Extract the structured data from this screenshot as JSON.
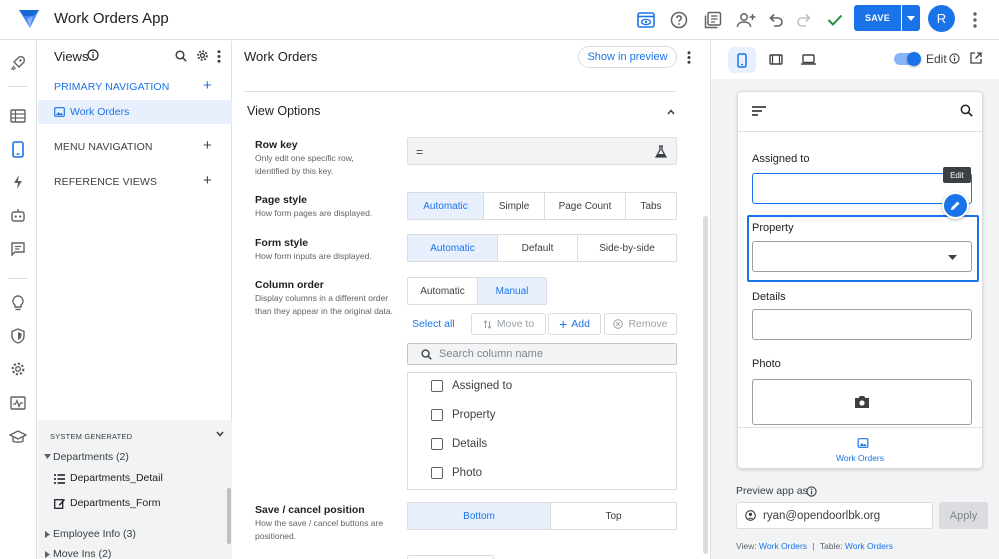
{
  "app": {
    "title": "Work Orders App",
    "save_label": "SAVE",
    "avatar_letter": "R",
    "brand_color": "#1a73e8"
  },
  "views_panel": {
    "title": "Views",
    "sections": [
      {
        "label": "PRIMARY NAVIGATION",
        "items": [
          "Work Orders"
        ]
      },
      {
        "label": "MENU NAVIGATION"
      },
      {
        "label": "REFERENCE VIEWS"
      }
    ],
    "system_generated": {
      "label": "SYSTEM GENERATED",
      "groups": [
        {
          "label": "Departments (2)",
          "children": [
            "Departments_Detail",
            "Departments_Form"
          ]
        },
        {
          "label": "Employee Info (3)"
        },
        {
          "label": "Move Ins (2)"
        }
      ]
    }
  },
  "center": {
    "title": "Work Orders",
    "show_preview": "Show in preview",
    "view_options": "View Options",
    "row_key": {
      "title": "Row key",
      "desc": "Only edit one specific row, identified by this key.",
      "value": "="
    },
    "page_style": {
      "title": "Page style",
      "desc": "How form pages are displayed.",
      "options": [
        "Automatic",
        "Simple",
        "Page Count",
        "Tabs"
      ],
      "selected": "Automatic"
    },
    "form_style": {
      "title": "Form style",
      "desc": "How form inputs are displayed.",
      "options": [
        "Automatic",
        "Default",
        "Side-by-side"
      ],
      "selected": "Automatic"
    },
    "column_order": {
      "title": "Column order",
      "desc": "Display columns in a different order than they appear in the original data.",
      "options": [
        "Automatic",
        "Manual"
      ],
      "selected": "Manual",
      "select_all": "Select all",
      "move_to": "Move to",
      "add": "Add",
      "remove": "Remove",
      "search_placeholder": "Search column name",
      "columns": [
        "Assigned to",
        "Property",
        "Details",
        "Photo"
      ]
    },
    "save_cancel": {
      "title": "Save / cancel position",
      "desc": "How the save / cancel buttons are positioned.",
      "options": [
        "Bottom",
        "Top"
      ],
      "selected": "Bottom"
    }
  },
  "preview": {
    "edit_label": "Edit",
    "edit_tooltip": "Edit",
    "fields": [
      "Assigned to",
      "Property",
      "Details",
      "Photo"
    ],
    "bottom_tab": "Work Orders",
    "preview_as_label": "Preview app as",
    "email": "ryan@opendoorlbk.org",
    "apply": "Apply",
    "footer": {
      "view_label": "View:",
      "view_value": "Work Orders",
      "sep": "|",
      "table_label": "Table:",
      "table_value": "Work Orders"
    }
  }
}
